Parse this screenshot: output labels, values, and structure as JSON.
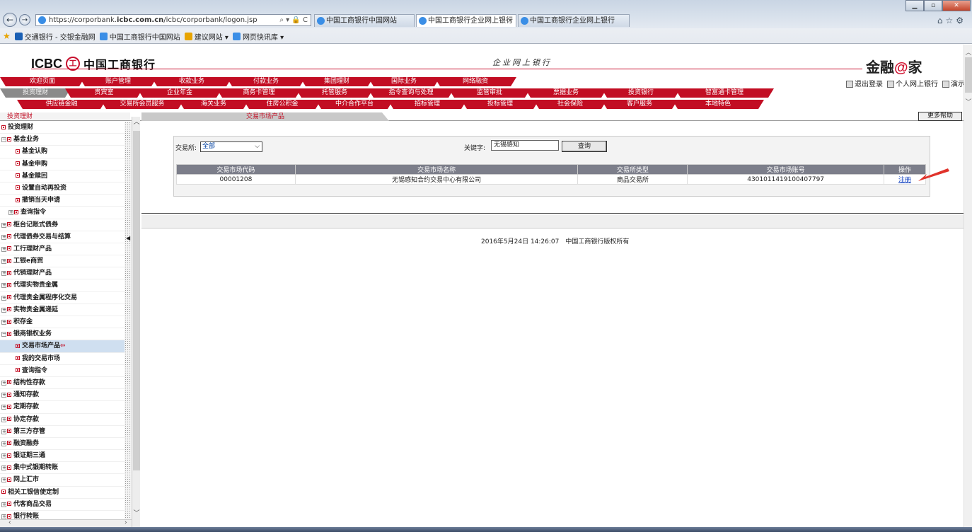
{
  "browser": {
    "url_prefix": "https://corporbank.",
    "url_domain": "icbc.com.cn",
    "url_path": "/icbc/corporbank/logon.jsp",
    "addr_controls": "⌕ ▾ 🔒 C",
    "tabs": [
      {
        "label": "中国工商银行中国网站"
      },
      {
        "label": "中国工商银行企业网上银行",
        "active": true
      },
      {
        "label": "中国工商银行企业网上银行"
      }
    ],
    "tab_close": "×",
    "favorites": [
      {
        "label": "交通银行 - 交银金融网",
        "color": "#1a5fb4"
      },
      {
        "label": "中国工商银行中国网站",
        "color": "#3a8ee6"
      },
      {
        "label": "建议网站 ▾",
        "color": "#e8a400"
      },
      {
        "label": "网页快讯库 ▾",
        "color": "#3a8ee6"
      }
    ]
  },
  "header": {
    "logo_en": "ICBC",
    "logo_seal": "工",
    "logo_cn": "中国工商银行",
    "product_title": "企业网上银行",
    "brand_prefix": "金融",
    "brand_at": "@",
    "brand_suffix": "家",
    "links": [
      "退出登录",
      "个人网上银行",
      "演示"
    ],
    "accent_color": "#c20d23"
  },
  "menu": {
    "row1": [
      "欢迎页面",
      "账户管理",
      "收款业务",
      "付款业务",
      "集团理财",
      "国际业务",
      "网络融资"
    ],
    "row2": [
      "投资理财",
      "贵宾室",
      "企业年金",
      "商务卡管理",
      "托管服务",
      "指令查询与处理",
      "监管审批",
      "票据业务",
      "投资银行",
      "智富通卡管理"
    ],
    "row3": [
      "供应链金融",
      "交易所会员服务",
      "海关业务",
      "住房公积金",
      "中介合作平台",
      "招标管理",
      "投标管理",
      "社会保险",
      "客户服务",
      "本地特色"
    ]
  },
  "sidebar": {
    "title": "投资理财",
    "items": [
      {
        "label": "投资理财",
        "level": "root",
        "toggle": ""
      },
      {
        "label": "基金业务",
        "level": "root",
        "toggle": "−"
      },
      {
        "label": "基金认购",
        "level": "level2",
        "toggle": ""
      },
      {
        "label": "基金申购",
        "level": "level2",
        "toggle": ""
      },
      {
        "label": "基金赎回",
        "level": "level2",
        "toggle": ""
      },
      {
        "label": "设置自动再投资",
        "level": "level2",
        "toggle": ""
      },
      {
        "label": "撤销当天申请",
        "level": "level2",
        "toggle": ""
      },
      {
        "label": "查询指令",
        "level": "level1",
        "toggle": "+"
      },
      {
        "label": "柜台记账式债券",
        "level": "root",
        "toggle": "+"
      },
      {
        "label": "代理债券交易与结算",
        "level": "root",
        "toggle": "+"
      },
      {
        "label": "工行理财产品",
        "level": "root",
        "toggle": "+"
      },
      {
        "label": "工银e商贸",
        "level": "root",
        "toggle": "+"
      },
      {
        "label": "代销理财产品",
        "level": "root",
        "toggle": "+"
      },
      {
        "label": "代理实物贵金属",
        "level": "root",
        "toggle": "+"
      },
      {
        "label": "代理贵金属程序化交易",
        "level": "root",
        "toggle": "+"
      },
      {
        "label": "实物贵金属递延",
        "level": "root",
        "toggle": "+"
      },
      {
        "label": "积存金",
        "level": "root",
        "toggle": "+"
      },
      {
        "label": "银商银权业务",
        "level": "root",
        "toggle": "−"
      },
      {
        "label": "交易市场产品",
        "level": "level2",
        "toggle": "",
        "selected": true
      },
      {
        "label": "我的交易市场",
        "level": "level2",
        "toggle": ""
      },
      {
        "label": "查询指令",
        "level": "level2",
        "toggle": ""
      },
      {
        "label": "结构性存款",
        "level": "root",
        "toggle": "+"
      },
      {
        "label": "通知存款",
        "level": "root",
        "toggle": "+"
      },
      {
        "label": "定期存款",
        "level": "root",
        "toggle": "+"
      },
      {
        "label": "协定存款",
        "level": "root",
        "toggle": "+"
      },
      {
        "label": "第三方存管",
        "level": "root",
        "toggle": "+"
      },
      {
        "label": "融资融券",
        "level": "root",
        "toggle": "+"
      },
      {
        "label": "银证期三通",
        "level": "root",
        "toggle": "+"
      },
      {
        "label": "集中式银期转账",
        "level": "root",
        "toggle": "+"
      },
      {
        "label": "网上汇市",
        "level": "root",
        "toggle": "+"
      },
      {
        "label": "相关工银信使定制",
        "level": "root",
        "toggle": ""
      },
      {
        "label": "代客商品交易",
        "level": "root",
        "toggle": "+"
      },
      {
        "label": "银行转账",
        "level": "root",
        "toggle": "+"
      }
    ]
  },
  "content": {
    "tab_label": "交易市场产品",
    "more_help": "更多帮助",
    "exchange_label": "交易所:",
    "exchange_value": "全部",
    "keyword_label": "关键字:",
    "keyword_value": "无锡感知",
    "query_button": "查询",
    "table": {
      "headers": [
        "交易市场代码",
        "交易市场名称",
        "交易所类型",
        "交易市场账号",
        "操作"
      ],
      "rows": [
        [
          "00001208",
          "无锡感知合约交易中心有限公司",
          "商品交易所",
          "4301011419100407797",
          "注册"
        ]
      ]
    },
    "footer": "2016年5月24日 14:26:07　中国工商银行版权所有"
  }
}
